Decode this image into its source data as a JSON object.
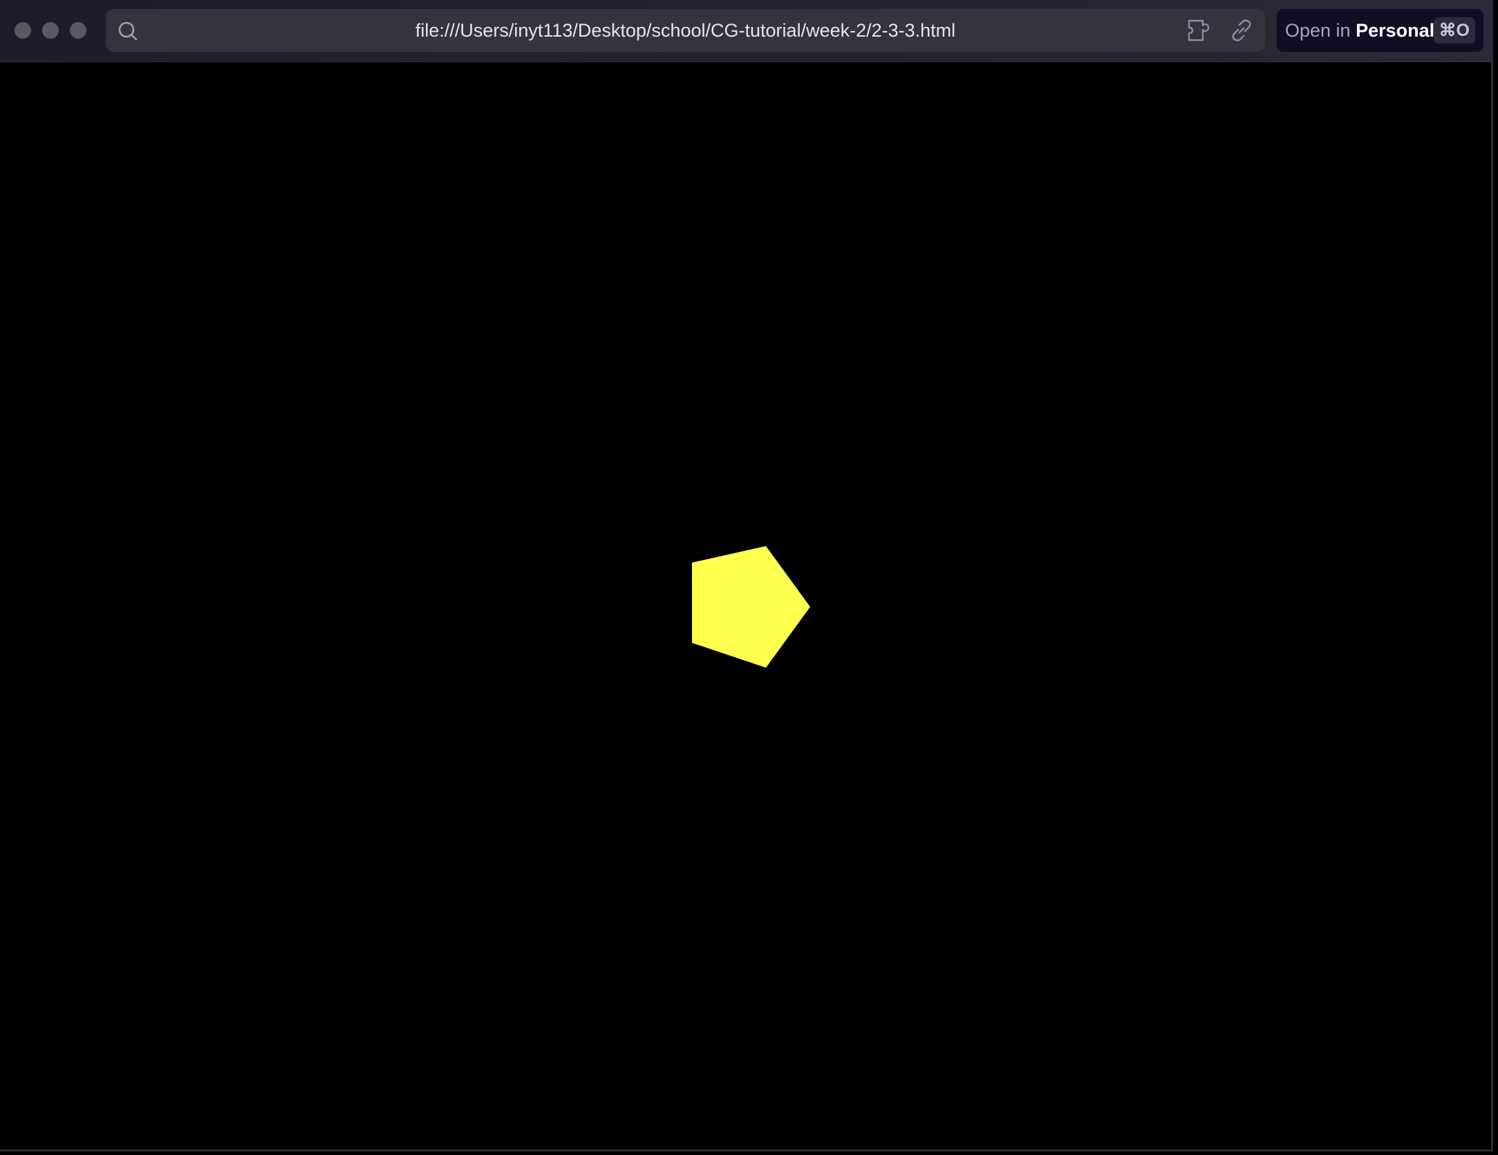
{
  "browser": {
    "url": "file:///Users/inyt113/Desktop/school/CG-tutorial/week-2/2-3-3.html",
    "open_in_prefix": "Open in",
    "open_in_target": "Personal",
    "shortcut": "⌘O",
    "icons": [
      "search-icon",
      "extension-icon",
      "link-icon"
    ]
  },
  "page": {
    "background_color": "#000000",
    "shape": {
      "kind": "pentagon",
      "fill_color": "#ffff4d"
    }
  }
}
